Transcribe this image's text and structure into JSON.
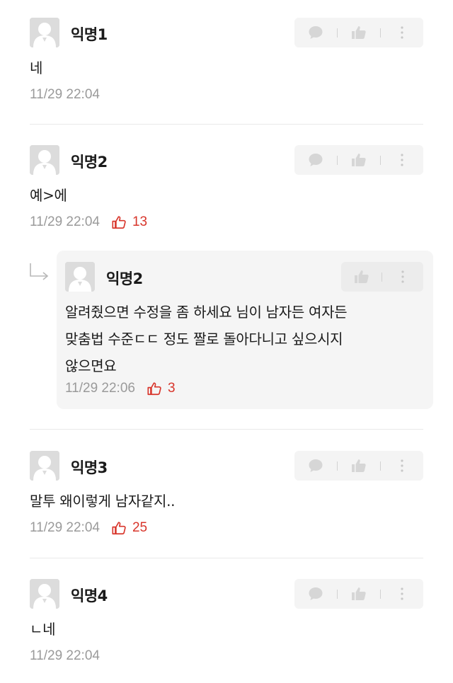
{
  "comments": [
    {
      "author": "익명1",
      "body": "네",
      "timestamp": "11/29 22:04",
      "likes": null
    },
    {
      "author": "익명2",
      "body": "예>에",
      "timestamp": "11/29 22:04",
      "likes": "13"
    },
    {
      "author": "익명3",
      "body": "말투 왜이렇게 남자같지..",
      "timestamp": "11/29 22:04",
      "likes": "25"
    },
    {
      "author": "익명4",
      "body": "ㄴ네",
      "timestamp": "11/29 22:04",
      "likes": null
    }
  ],
  "reply": {
    "author": "익명2",
    "lines": [
      "알려줬으면 수정을 좀 하세요 님이 남자든 여자든",
      "맞춤법 수준ㄷㄷ 정도 짤로 돌아다니고 싶으시지",
      "않으면요"
    ],
    "timestamp": "11/29 22:06",
    "likes": "3"
  },
  "icons": {
    "reply": "speech-bubble-icon",
    "like": "thumbs-up-icon",
    "more": "more-vertical-icon",
    "reply_indicator": "reply-arrow-icon"
  },
  "colors": {
    "like": "#d8352b",
    "meta": "#9a9a9a",
    "action_bg": "#f4f4f4"
  }
}
